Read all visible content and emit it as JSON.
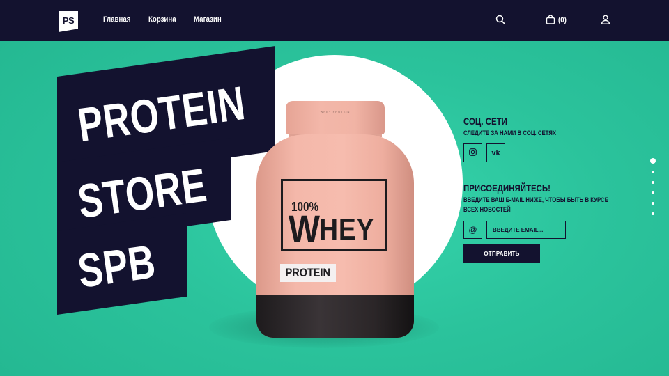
{
  "header": {
    "logo": "PS",
    "nav": [
      {
        "label": "Главная"
      },
      {
        "label": "Корзина"
      },
      {
        "label": "Магазин"
      }
    ],
    "cart_count": "(0)",
    "icons": [
      "search-icon",
      "bag-icon",
      "user-icon"
    ]
  },
  "hero": {
    "lines": [
      "PROTEIN",
      "STORE",
      "SPB"
    ]
  },
  "product": {
    "lid_text": "WHEY PROTEIN",
    "label_percent": "100%",
    "label_w": "W",
    "label_hey": "HEY",
    "label_protein": "PROTEIN"
  },
  "social": {
    "title": "СОЦ. СЕТИ",
    "subtitle": "СЛЕДИТЕ ЗА НАМИ В СОЦ. СЕТЯХ",
    "icons": [
      "instagram-icon",
      "vk-icon"
    ],
    "vk_text": "vk"
  },
  "subscribe": {
    "title": "ПРИСОЕДИНЯЙТЕСЬ!",
    "text": "ВВЕДИТЕ ВАШ E-MAIL НИЖЕ, ЧТОБЫ БЫТЬ В КУРСЕ ВСЕХ НОВОСТЕЙ",
    "at_symbol": "@",
    "email_placeholder": "ВВЕДИТЕ EMAIL...",
    "button_label": "ОТПРАВИТЬ"
  },
  "pager": {
    "count": 6,
    "active": 1
  },
  "colors": {
    "navy": "#13122f",
    "teal": "#2ec49f",
    "jar_pink": "#f4b8aa"
  }
}
